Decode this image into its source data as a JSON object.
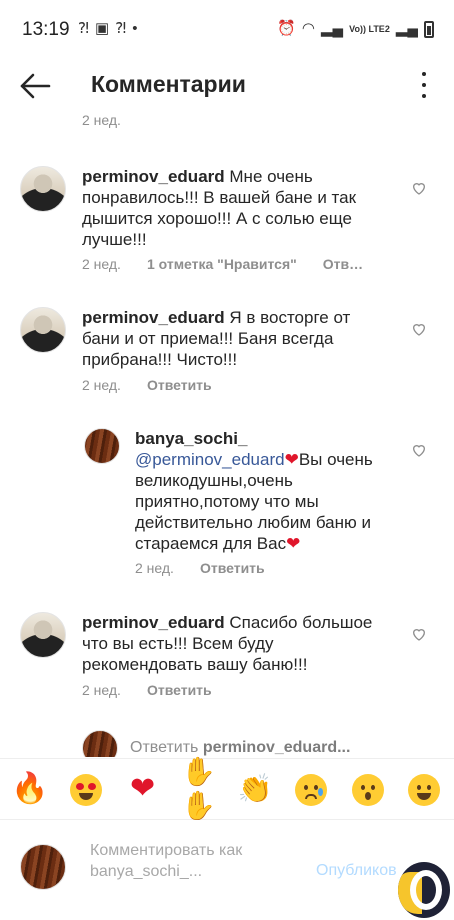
{
  "status_bar": {
    "time": "13:19",
    "lte_label": "Vo)) LTE2",
    "dot": "•"
  },
  "header": {
    "title": "Комментарии",
    "back_icon": "arrow-left-icon",
    "more_icon": "more-vertical-icon"
  },
  "previous_meta": "2 нед.",
  "comments": [
    {
      "username": "perminov_eduard",
      "text": "Мне очень понравилось!!! В вашей бане и так дышится хорошо!!! А с солью еще лучше!!!",
      "time": "2 нед.",
      "likes": "1 отметка \"Нравится\"",
      "reply_label": "Отв…"
    },
    {
      "username": "perminov_eduard",
      "text": "Я в восторге от бани и от приема!!! Баня всегда прибрана!!! Чисто!!!",
      "time": "2 нед.",
      "reply_label": "Ответить"
    },
    {
      "username": "banya_sochi_",
      "mention": "@perminov_eduard",
      "text": "Вы очень великодушны,очень приятно,потому что мы действительно любим баню и стараемся для Вас",
      "time": "2 нед.",
      "reply_label": "Ответить"
    },
    {
      "username": "perminov_eduard",
      "text": "Спасибо большое что вы есть!!! Всем буду рекомендовать вашу баню!!!",
      "time": "2 нед.",
      "reply_label": "Ответить"
    }
  ],
  "reply_bar": {
    "prefix": "Ответить",
    "username": "perminov_eduard..."
  },
  "emoji_bar": [
    "fire",
    "heart-eyes",
    "red-heart",
    "raised-hands",
    "clapping-hands",
    "crying-face",
    "surprised-face",
    "tears-of-joy"
  ],
  "composer": {
    "placeholder": "Комментировать как banya_sochi_...",
    "publish_label": "Опубликов"
  },
  "colors": {
    "text": "#262626",
    "secondary": "#8e8e8e",
    "publish": "#b3dbff",
    "heart": "#e0162b"
  }
}
